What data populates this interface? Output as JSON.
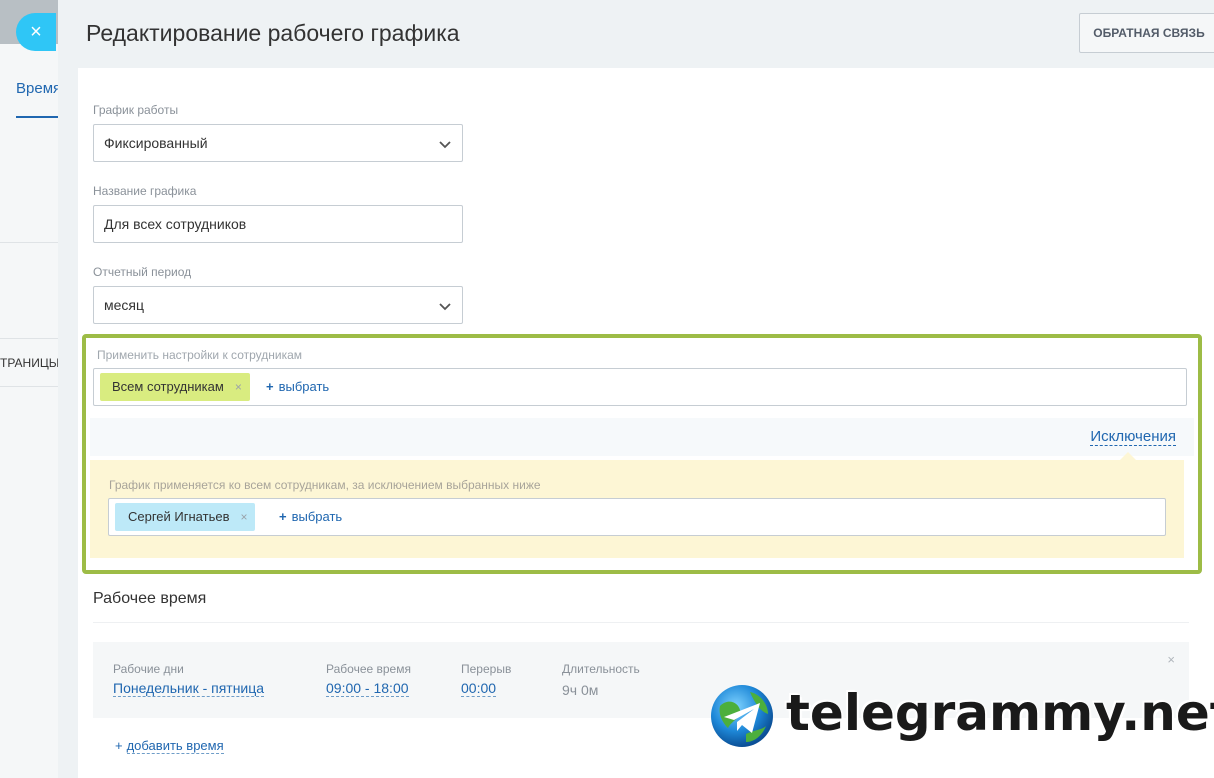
{
  "background_page": {
    "tab_label": "Время",
    "side_label": "ТРАНИЦЫ:"
  },
  "close_icon": "×",
  "slider": {
    "title": "Редактирование рабочего графика",
    "feedback_label": "ОБРАТНАЯ СВЯЗЬ"
  },
  "form": {
    "schedule_type": {
      "label": "График работы",
      "value": "Фиксированный"
    },
    "schedule_name": {
      "label": "Название графика",
      "value": "Для всех сотрудников"
    },
    "report_period": {
      "label": "Отчетный период",
      "value": "месяц"
    },
    "apply_to": {
      "label": "Применить настройки к сотрудникам",
      "tag": "Всем сотрудникам",
      "choose_label": "выбрать"
    },
    "exceptions": {
      "link_label": "Исключения",
      "description": "График применяется ко всем сотрудникам, за исключением выбранных ниже",
      "tag": "Сергей Игнатьев",
      "choose_label": "выбрать"
    }
  },
  "working_time": {
    "title": "Рабочее время",
    "rows": [
      {
        "days_label": "Рабочие дни",
        "days_value": "Понедельник - пятница",
        "time_label": "Рабочее время",
        "time_value": "09:00 - 18:00",
        "break_label": "Перерыв",
        "break_value": "00:00",
        "duration_label": "Длительность",
        "duration_value": "9ч 0м"
      }
    ],
    "add_label": "добавить время"
  },
  "watermark": {
    "text": "telegrammy.net"
  },
  "colors": {
    "accent_blue": "#2067b0",
    "close_button": "#2fc6f6",
    "highlight_frame": "#9dbc46",
    "tag_green": "#d9ec80",
    "tag_blue": "#bde9f8",
    "exceptions_bg": "#fdf6d5"
  }
}
